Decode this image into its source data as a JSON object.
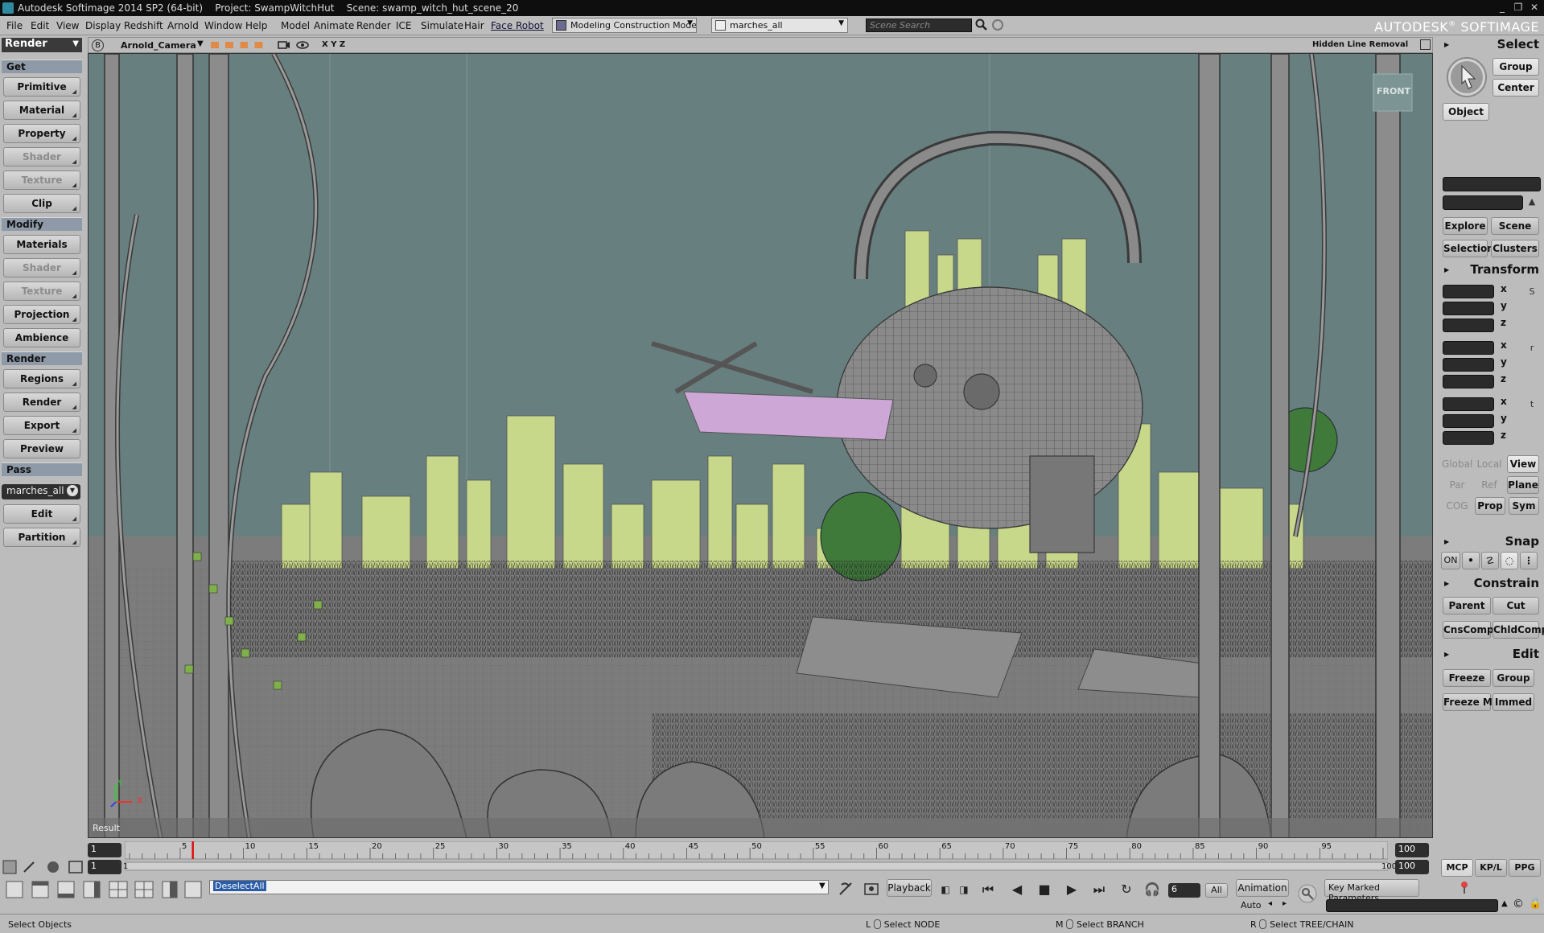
{
  "titlebar": {
    "title": "Autodesk Softimage 2014 SP2 (64-bit)    Project: SwampWitchHut    Scene: swamp_witch_hut_scene_20",
    "min": "_",
    "max": "❐",
    "close": "✕"
  },
  "menubar": {
    "items": [
      "File",
      "Edit",
      "View",
      "Display",
      "Redshift",
      "Arnold",
      "Window",
      "Help",
      "Model",
      "Animate",
      "Render",
      "ICE",
      "Simulate",
      "Hair",
      "Face Robot"
    ],
    "construction_mode": "Modeling Construction Mode",
    "pass_selector": "marches_all",
    "search_placeholder": "Scene Search",
    "brand": "AUTODESK",
    "brand_product": "SOFTIMAGE",
    "brand_mark": "®"
  },
  "leftpanel": {
    "mode": "Render",
    "sections": {
      "get": "Get",
      "modify": "Modify",
      "render": "Render",
      "pass": "Pass"
    },
    "get_buttons": [
      "Primitive",
      "Material",
      "Property",
      "Shader",
      "Texture",
      "Clip"
    ],
    "modify_buttons": [
      "Materials",
      "Shader",
      "Texture",
      "Projection",
      "Ambience"
    ],
    "render_buttons": [
      "Regions",
      "Render",
      "Export",
      "Preview"
    ],
    "pass_value": "marches_all",
    "pass_buttons": [
      "Edit",
      "Partition"
    ]
  },
  "viewport": {
    "letter": "B",
    "camera": "Arnold_Camera",
    "axes": "X Y Z",
    "display_mode": "Hidden Line Removal",
    "view_cube": "FRONT",
    "result_label": "Result",
    "axis_x": "X",
    "axis_y": "Y"
  },
  "rightpanel": {
    "select_hdr": "Select",
    "group": "Group",
    "center": "Center",
    "object": "Object",
    "explore": "Explore",
    "scene": "Scene",
    "selection": "Selection",
    "clusters": "Clusters",
    "transform_hdr": "Transform",
    "axes": [
      "x",
      "y",
      "z"
    ],
    "tf_icons": [
      "S",
      "r",
      "t"
    ],
    "global": "Global",
    "local": "Local",
    "view": "View",
    "par": "Par",
    "ref": "Ref",
    "plane": "Plane",
    "cog": "COG",
    "prop": "Prop",
    "sym": "Sym",
    "snap_hdr": "Snap",
    "snap_on": "ON",
    "constrain_hdr": "Constrain",
    "parent": "Parent",
    "cut": "Cut",
    "cnscomp": "CnsComp",
    "chldcomp": "ChldComp",
    "edit_hdr": "Edit",
    "freeze": "Freeze",
    "edit_group": "Group",
    "freeze_m": "Freeze M",
    "immed": "Immed",
    "tabs": [
      "MCP",
      "KP/L",
      "PPG"
    ]
  },
  "timeline": {
    "start": "1",
    "current_start": "1",
    "end": "100",
    "end2": "100",
    "range_start": "1",
    "range_end_label": "100",
    "ticks": [
      "5",
      "10",
      "15",
      "20",
      "25",
      "30",
      "35",
      "40",
      "45",
      "50",
      "55",
      "60",
      "65",
      "70",
      "75",
      "80",
      "85",
      "90",
      "95"
    ],
    "current_frame": 6
  },
  "bottombar": {
    "command": "DeselectAll",
    "playback": "Playback",
    "frame": "6",
    "all": "All",
    "animation": "Animation",
    "auto": "Auto",
    "key_marked": "Key Marked Parameters"
  },
  "statusbar": {
    "hint": "Select Objects",
    "l_label": "L",
    "l_action": "Select NODE",
    "m_label": "M",
    "m_action": "Select BRANCH",
    "r_label": "R",
    "r_action": "Select TREE/CHAIN"
  },
  "colors": {
    "viewport_bg": "#687f7f",
    "highlight_green": "#c8d88a",
    "pink": "#cda8d6",
    "accent_blue": "#2b5ca8"
  }
}
